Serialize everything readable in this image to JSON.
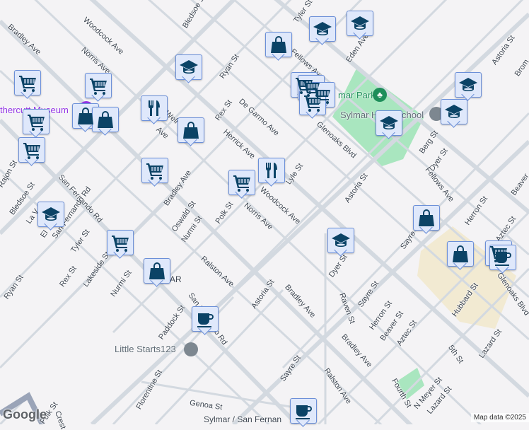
{
  "map": {
    "colors": {
      "background": "#f4f3f5",
      "road": "#d3d9e0",
      "park": "#a9e6bf",
      "campus": "#f2ead2",
      "marker_fill": "#dfe8fb",
      "marker_border": "#6b8fd8",
      "icon": "#0b4366",
      "poi_purple": "#9334e6",
      "poi_green": "#1e8e5a",
      "poi_grey": "#5f6b75"
    },
    "streets": [
      "Bradley Ave",
      "Woodcock Ave",
      "Norris Ave",
      "Bledsoe St",
      "Ryan St",
      "Tyler St",
      "Eden Ave",
      "Astoria St",
      "Brom",
      "Fellows Ave",
      "De Garmo Ave",
      "Rex St",
      "Herrick Ave",
      "Lyle St",
      "Glenoaks Blvd",
      "Berg St",
      "Dyer St",
      "Fellows Ave",
      "Beaver",
      "Herron St",
      "Aztec St",
      "Sayre St",
      "Hubbard St",
      "Glenoaks Blvd",
      "Astoria St",
      "Woodcock Ave",
      "Norris Ave",
      "Polk St",
      "Bradley Ave",
      "Oswald St",
      "Nurmi St",
      "San Fernando Rd",
      "San Fernando Rd",
      "Bledsoe St",
      "La V",
      "El",
      "Tyler St",
      "Rex St",
      "Lakeside St",
      "Nurmi St",
      "Ryan St",
      "Ralston Ave",
      "Astoria St",
      "Bradley Ave",
      "Dyer St",
      "Raven St",
      "Sayre St",
      "Herron St",
      "Beaver St",
      "Aztec St",
      "5th St",
      "Lazard St",
      "Paddock St",
      "San Fernando Rd",
      "Bradley Ave",
      "Fourth St",
      "N Meyer St",
      "Lazard St",
      "Sayre St",
      "Ralston Ave",
      "Florentine St",
      "Genoa St",
      "Sylmar / San Fernan",
      "Polk St",
      "Crest",
      "Ave",
      "Rajon St",
      "Well"
    ],
    "pois": {
      "museum": "thercutt Museum",
      "park": "mar Park",
      "school": "Sylmar H",
      "school2": "chool",
      "little": "Little Starts123",
      "ar": "AR"
    },
    "markers": [
      "graduation-cap",
      "graduation-cap",
      "shopping-bag",
      "graduation-cap",
      "shopping-cart",
      "shopping-cart",
      "shopping-cart",
      "shopping-cart",
      "shopping-cart",
      "shopping-cart",
      "graduation-cap",
      "graduation-cap",
      "graduation-cap",
      "restaurant",
      "shopping-bag",
      "shopping-bag",
      "shopping-cart",
      "shopping-cart",
      "shopping-bag",
      "shopping-cart",
      "shopping-cart",
      "restaurant",
      "graduation-cap",
      "shopping-cart",
      "graduation-cap",
      "shopping-bag",
      "shopping-bag",
      "shopping-cart",
      "coffee",
      "shopping-bag",
      "coffee",
      "coffee"
    ],
    "logo": "Google",
    "attribution": "Map data ©2025"
  }
}
